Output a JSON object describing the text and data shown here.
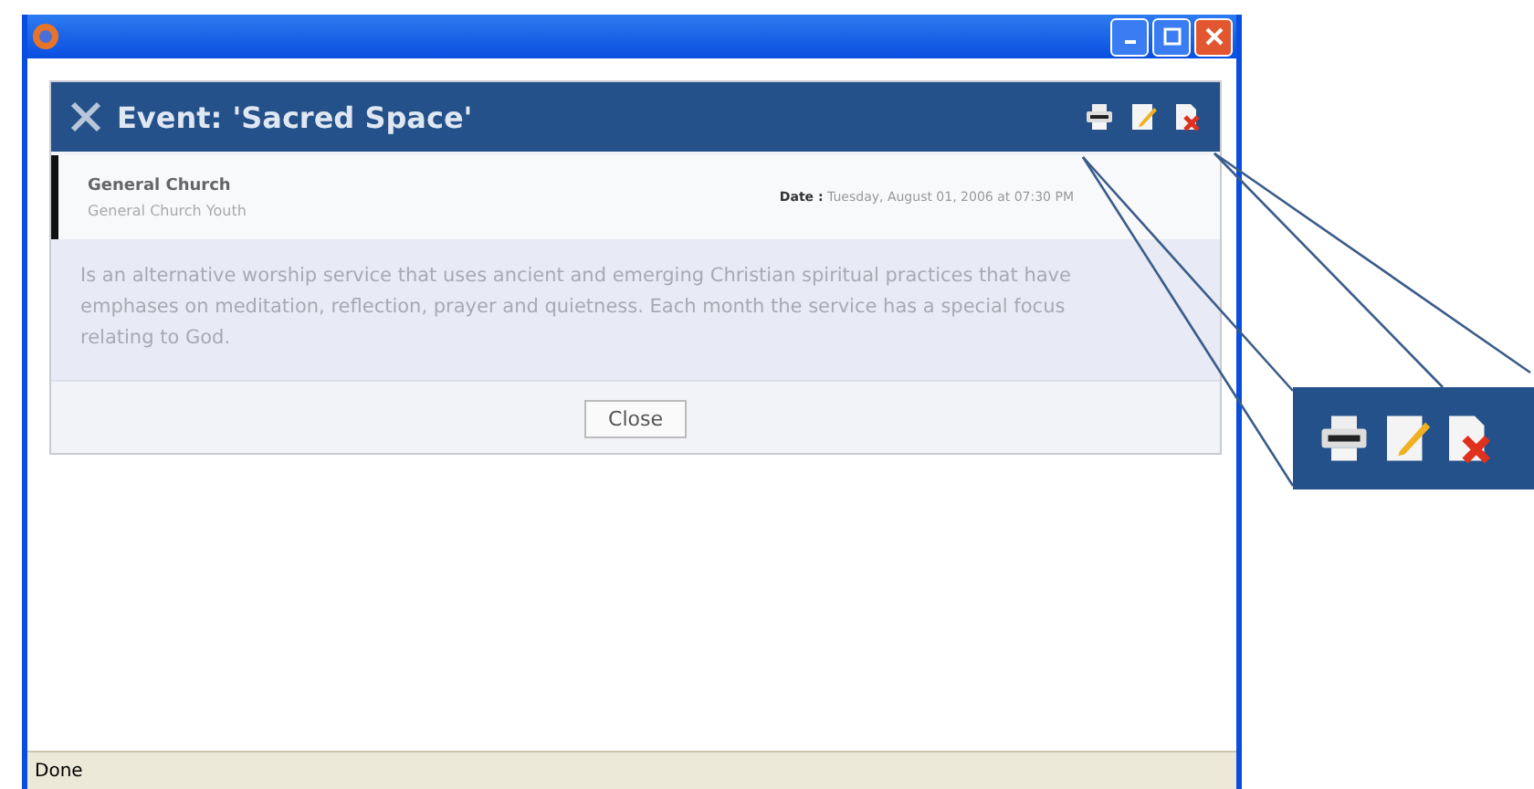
{
  "window": {
    "buttons": [
      {
        "kind": "minimize"
      },
      {
        "kind": "maximize"
      },
      {
        "kind": "close"
      }
    ]
  },
  "dialog": {
    "title": "Event: 'Sacred Space'",
    "toolbar": [
      {
        "kind": "print"
      },
      {
        "kind": "edit"
      },
      {
        "kind": "delete"
      }
    ],
    "organizer": "General Church",
    "group": "General Church Youth",
    "date_label": "Date :",
    "date": "Tuesday, August 01, 2006 at 07:30 PM",
    "description": "Is an alternative worship service that uses ancient and emerging Christian spiritual practices that have emphases on meditation, reflection, prayer and quietness. Each month the service has a special focus relating to God.",
    "button": "Close"
  },
  "status_bar": "Done",
  "callout": {
    "icons": [
      {
        "kind": "print"
      },
      {
        "kind": "edit"
      },
      {
        "kind": "delete"
      }
    ]
  }
}
